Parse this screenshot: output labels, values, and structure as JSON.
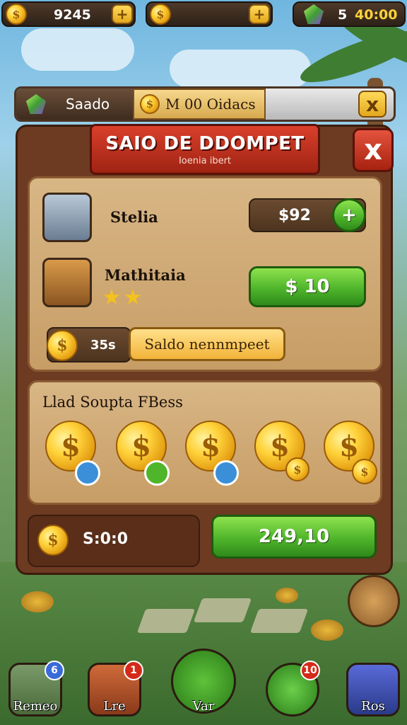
{
  "top_bar": {
    "coins_value": "9245",
    "gems_label": "5",
    "timer_value": "40:00",
    "plus_symbol": "+"
  },
  "sub_bar": {
    "left_tab": "Saado",
    "mid_tab": "M 00 Oidacs",
    "close_symbol": "x"
  },
  "panel": {
    "title": "SAIO DE DDOMPET",
    "subtitle": "Ioenia ibert",
    "close_symbol": "x"
  },
  "items": [
    {
      "label": "Stelia",
      "price": "$92",
      "action": "+"
    },
    {
      "label": "Mathitaia",
      "price": "$ 10",
      "stars": 2
    }
  ],
  "coins_row": {
    "amount": "35s",
    "button_label": "Saldo nennmpeet"
  },
  "bundle": {
    "title": "Llad Soupta FBess",
    "coin_symbol": "$"
  },
  "footer": {
    "balance": "S:0:0",
    "buy_label": "249,10"
  },
  "nav": [
    {
      "label": "Remeo",
      "badge": "6"
    },
    {
      "label": "Lre",
      "badge": "1"
    },
    {
      "label": "Var",
      "badge": ""
    },
    {
      "label": "",
      "badge": "10"
    },
    {
      "label": "Ros",
      "badge": ""
    }
  ],
  "colors": {
    "accent_red": "#c32e1a",
    "accent_green": "#4fb52b",
    "gold": "#ffd23a"
  }
}
